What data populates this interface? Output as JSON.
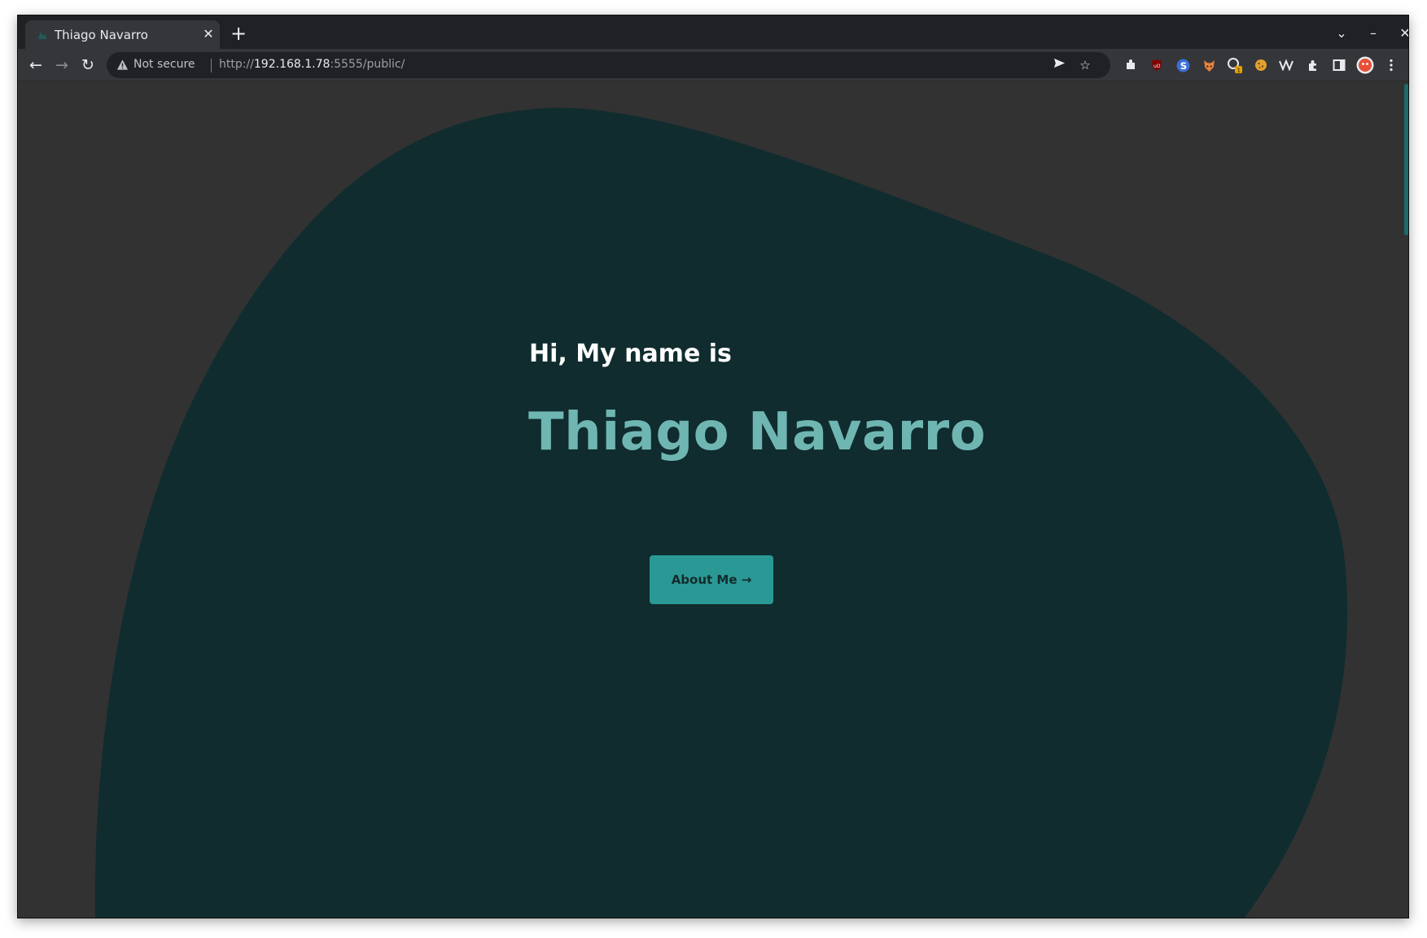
{
  "browser": {
    "tab_title": "Thiago Navarro",
    "tab_close": "✕",
    "new_tab": "+",
    "controls": {
      "tab_search": "⌄",
      "minimize": "–",
      "close": "✕"
    },
    "nav": {
      "back": "←",
      "forward": "→",
      "reload": "↻"
    },
    "security_label": "Not secure",
    "url_scheme": "http://",
    "url_host": "192.168.1.78",
    "url_rest": ":5555/public/",
    "icons": [
      "send-icon",
      "bookmark-star-icon",
      "extension-puzzle-icon",
      "ublock-icon",
      "s-extension-icon",
      "fox-extension-icon",
      "sync-extension-icon",
      "cookie-extension-icon",
      "wappalyzer-icon",
      "extensions-icon",
      "side-panel-icon",
      "profile-avatar",
      "menu-icon"
    ],
    "extension_badge": "1"
  },
  "hero": {
    "greeting": "Hi, My name is",
    "name": "Thiago Navarro",
    "cta_label": "About Me →"
  },
  "colors": {
    "page_background": "#323232",
    "blob": "#102c2e",
    "name_text": "#6fb6b3",
    "button_bg": "#2a9996"
  }
}
